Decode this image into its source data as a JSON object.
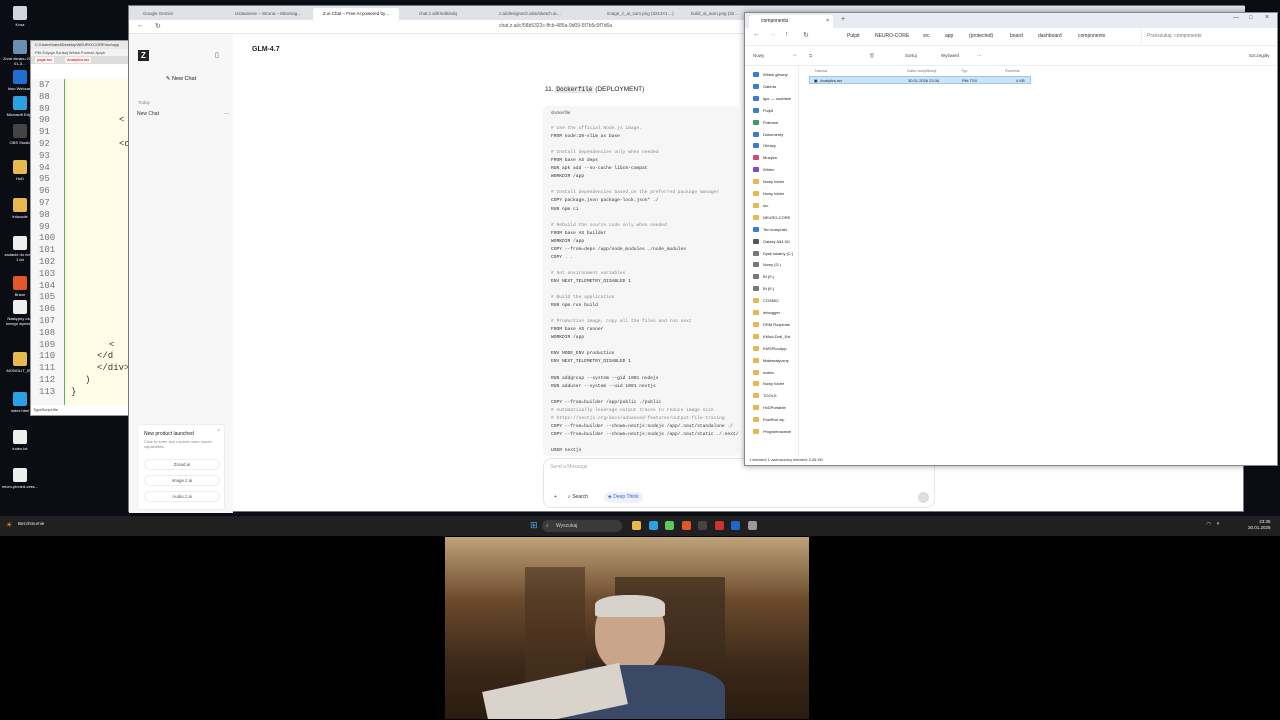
{
  "desktop": {
    "icons": [
      {
        "label": "Kosz",
        "color": "#cfd6df"
      },
      {
        "label": "Zrzut ekranu 2026-01-3…",
        "color": "#6a8fb0"
      },
      {
        "label": "Iriun Webcam",
        "color": "#1f6fd1"
      },
      {
        "label": "Microsoft Edge",
        "color": "#2aa1e2"
      },
      {
        "label": "OBS Studio",
        "color": "#444"
      },
      {
        "label": "HxD",
        "color": "#e7b84b"
      },
      {
        "label": "Intocode",
        "color": "#e7b84b"
      },
      {
        "label": "zadanie do nowej 1.txt",
        "color": "#eee"
      },
      {
        "label": "Brave",
        "color": "#e2572a"
      },
      {
        "label": "Następny czat innego wymiaru",
        "color": "#eee"
      },
      {
        "label": "MONOLIT_IBS",
        "color": "#e7b84b"
      },
      {
        "label": "index.html",
        "color": "#2aa1e2"
      },
      {
        "label": "index.txt",
        "color": "#eee"
      },
      {
        "label": "micro-pinned-cess...",
        "color": "#eee"
      }
    ]
  },
  "editor": {
    "title": "C:\\Users\\hand\\Desktop\\NEURO-CORE\\src\\app",
    "menu": "Plik Edycja Szukaj Widok Format Język",
    "tabs": [
      "page.tsx",
      "Analytics.tsx"
    ],
    "lines": [
      "87",
      "88",
      "89",
      "90",
      "91",
      "92",
      "93",
      "94",
      "95",
      "96",
      "97",
      "98",
      "99",
      "100",
      "101",
      "102",
      "103",
      "104",
      "105",
      "106",
      "107",
      "108",
      "109",
      "110",
      "111",
      "112",
      "113"
    ],
    "code": [
      {
        "line": 3,
        "text": "<"
      },
      {
        "line": 5,
        "text": "<c"
      },
      {
        "line": 22,
        "text": "<"
      },
      {
        "line": 23,
        "text": "</d"
      },
      {
        "line": 24,
        "text": "</div>"
      },
      {
        "line": 25,
        "text": ")"
      },
      {
        "line": 26,
        "text": "}"
      }
    ],
    "status": "TypeScript file"
  },
  "browser": {
    "tabs": [
      {
        "label": "Google Gemini",
        "active": false
      },
      {
        "label": "Ustawienie – Strona – Minimag…",
        "active": false
      },
      {
        "label": "Z.ai Chat – Free AI powered by…",
        "active": true
      },
      {
        "label": "chat.z.ai/fr/edit/edq",
        "active": false
      },
      {
        "label": "z.ai/designer/z.ai/ai/sketch.ai…",
        "active": false
      },
      {
        "label": "image_z_ai_sum.png (3213×1…)",
        "active": false
      },
      {
        "label": "build_ai_aum.png (32…",
        "active": false
      }
    ],
    "url": "chat.z.ai/c/58b5322c-ffcb-485a-9d09-5f7b5c9f7d6a",
    "logo": "Z",
    "new_chat": "New Chat",
    "section": "Today",
    "chat_item": "New Chat",
    "model": "GLM-4.7",
    "promo": {
      "title": "New product launched",
      "desc": "Click to enter and explore more model capabilities.",
      "links": [
        "Zread.ai",
        "image.z.ai",
        "Audio.z.ai"
      ]
    },
    "message_heading": {
      "num": "11.",
      "code": "Dockerfile",
      "rest": "(DEPLOYMENT)"
    },
    "code_lang": "dockerfile",
    "code_lines": [
      {
        "t": "# Use the official Node.js image.",
        "c": true
      },
      {
        "t": "FROM node:20-slim as base",
        "c": false
      },
      {
        "t": "",
        "c": false
      },
      {
        "t": "# Install dependencies only when needed",
        "c": true
      },
      {
        "t": "FROM base AS deps",
        "c": false
      },
      {
        "t": "RUN apk add --no-cache libc6-compat",
        "c": false
      },
      {
        "t": "WORKDIR /app",
        "c": false
      },
      {
        "t": "",
        "c": false
      },
      {
        "t": "# Install dependencies based on the preferred package manager",
        "c": true
      },
      {
        "t": "COPY package.json package-lock.json* ./",
        "c": false
      },
      {
        "t": "RUN npm ci",
        "c": false
      },
      {
        "t": "",
        "c": false
      },
      {
        "t": "# Rebuild the source code only when needed",
        "c": true
      },
      {
        "t": "FROM base AS builder",
        "c": false
      },
      {
        "t": "WORKDIR /app",
        "c": false
      },
      {
        "t": "COPY --from=deps /app/node_modules ./node_modules",
        "c": false
      },
      {
        "t": "COPY . .",
        "c": false
      },
      {
        "t": "",
        "c": false
      },
      {
        "t": "# Set environment variables",
        "c": true
      },
      {
        "t": "ENV NEXT_TELEMETRY_DISABLED 1",
        "c": false
      },
      {
        "t": "",
        "c": false
      },
      {
        "t": "# Build the application",
        "c": true
      },
      {
        "t": "RUN npm run build",
        "c": false
      },
      {
        "t": "",
        "c": false
      },
      {
        "t": "# Production image, copy all the files and run next",
        "c": true
      },
      {
        "t": "FROM base AS runner",
        "c": false
      },
      {
        "t": "WORKDIR /app",
        "c": false
      },
      {
        "t": "",
        "c": false
      },
      {
        "t": "ENV NODE_ENV production",
        "c": false
      },
      {
        "t": "ENV NEXT_TELEMETRY_DISABLED 1",
        "c": false
      },
      {
        "t": "",
        "c": false
      },
      {
        "t": "RUN addgroup --system --gid 1001 nodejs",
        "c": false
      },
      {
        "t": "RUN adduser --system --uid 1001 nextjs",
        "c": false
      },
      {
        "t": "",
        "c": false
      },
      {
        "t": "COPY --from=builder /app/public ./public",
        "c": false
      },
      {
        "t": "# Automatically leverage output traces to reduce image size",
        "c": true
      },
      {
        "t": "# https://nextjs.org/docs/advanced-features/output-file-tracing",
        "c": true
      },
      {
        "t": "COPY --from=builder --chown=nextjs:nodejs /app/.next/standalone ./",
        "c": false
      },
      {
        "t": "COPY --from=builder --chown=nextjs:nodejs /app/.next/static ./.next/static",
        "c": false
      },
      {
        "t": "",
        "c": false
      },
      {
        "t": "USER nextjs",
        "c": false
      }
    ],
    "input_placeholder": "Send a Message",
    "search_btn": "Search",
    "deep_think_btn": "Deep Think"
  },
  "explorer": {
    "tab_title": "components",
    "breadcrumbs": [
      "Pulpit",
      "NEURO-CORE",
      "src",
      "app",
      "(protected)",
      "board",
      "dashboard",
      "components"
    ],
    "search_placeholder": "Przeszukaj: components",
    "toolbar": {
      "new": "Nowy",
      "sort": "Sortuj",
      "view": "Wyświetl",
      "details": "Szczegóły"
    },
    "columns": [
      "Nazwa",
      "Data modyfikacji",
      "Typ",
      "Rozmiar"
    ],
    "file": {
      "name": "Analytics.tsx",
      "date": "30.01.2026 23:34",
      "type": "Plik TSX",
      "size": "4 KB"
    },
    "nav": [
      {
        "label": "Widok główny",
        "color": "#3a7bd5"
      },
      {
        "label": "Galeria",
        "color": "#3a7bd5"
      },
      {
        "label": "igor — osobiste",
        "color": "#3a7bd5"
      },
      {
        "label": "Pulpit",
        "color": "#3a7bd5"
      },
      {
        "label": "Pobrane",
        "color": "#3a9b5a"
      },
      {
        "label": "Dokumenty",
        "color": "#3a7bd5"
      },
      {
        "label": "Obrazy",
        "color": "#3a7bd5"
      },
      {
        "label": "Muzyka",
        "color": "#d54a7a"
      },
      {
        "label": "Wideo",
        "color": "#7a4ad5"
      },
      {
        "label": "Nowy folder",
        "color": "#e7b84b"
      },
      {
        "label": "Nowy folder",
        "color": "#e7b84b"
      },
      {
        "label": "src",
        "color": "#e7b84b"
      },
      {
        "label": "NEURO-CORE",
        "color": "#e7b84b"
      },
      {
        "label": "Ten komputer",
        "color": "#3a7bd5"
      },
      {
        "label": "Galaxy A54 5G",
        "color": "#555"
      },
      {
        "label": "Dysk lokalny (C:)",
        "color": "#777"
      },
      {
        "label": "Nowy (D:)",
        "color": "#777"
      },
      {
        "label": "BI (E:)",
        "color": "#777"
      },
      {
        "label": "BI (E:)",
        "color": "#777"
      },
      {
        "label": "COSMIC",
        "color": "#e7b84b"
      },
      {
        "label": "debugger",
        "color": "#e7b84b"
      },
      {
        "label": "DRM Rozpinak",
        "color": "#e7b84b"
      },
      {
        "label": "KMod-DrdI_Ext",
        "color": "#e7b84b"
      },
      {
        "label": "KMSPicoApp",
        "color": "#e7b84b"
      },
      {
        "label": "Matematyczny",
        "color": "#e7b84b"
      },
      {
        "label": "matrix",
        "color": "#e7b84b"
      },
      {
        "label": "Nowy folder",
        "color": "#e7b84b"
      },
      {
        "label": "TOOLS",
        "color": "#e7b84b"
      },
      {
        "label": "HxDPortable",
        "color": "#e7b84b"
      },
      {
        "label": "PowRun.zip",
        "color": "#e7b84b"
      },
      {
        "label": "Programowanie",
        "color": "#e7b84b"
      }
    ],
    "status": "1 element   1 zaznaczony element  3,45 KB"
  },
  "taskbar": {
    "search": "Wyszukaj",
    "weather": "Bezchmurnie",
    "time": "23:35",
    "date": "30.01.2026",
    "apps": [
      {
        "color": "#e7b84b"
      },
      {
        "color": "#2aa1e2"
      },
      {
        "color": "#5ac85a"
      },
      {
        "color": "#e2572a"
      },
      {
        "color": "#444"
      },
      {
        "color": "#c33"
      },
      {
        "color": "#2266cc"
      },
      {
        "color": "#999"
      }
    ]
  }
}
